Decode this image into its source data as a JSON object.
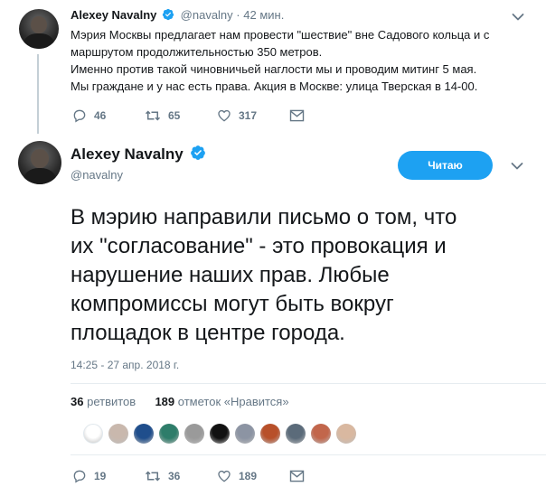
{
  "tweet1": {
    "name": "Alexey Navalny",
    "handle": "@navalny",
    "time": "42 мин.",
    "lines": [
      "Мэрия Москвы предлагает нам провести \"шествие\" вне Садового кольца и с",
      "маршрутом продолжительностью 350 метров.",
      "Именно против такой чиновничьей наглости мы и проводим митинг 5 мая.",
      "Мы граждане и у нас есть права. Акция в Москве: улица Тверская в 14-00."
    ],
    "replies": "46",
    "retweets": "65",
    "likes": "317"
  },
  "tweet2": {
    "name": "Alexey Navalny",
    "handle": "@navalny",
    "follow_label": "Читаю",
    "lines": [
      "В мэрию направили письмо о том, что",
      "их \"согласование\" - это провокация и",
      "нарушение наших прав. Любые",
      "компромиссы могут быть вокруг",
      "площадок в центре города."
    ],
    "timestamp": "14:25 - 27 апр. 2018 г.",
    "retweet_count": "36",
    "retweet_label": "ретвитов",
    "like_count": "189",
    "like_label": "отметок «Нравится»",
    "liker_colors": [
      "#ffffff",
      "#c9b8ad",
      "#1f4e8c",
      "#2e7d6a",
      "#9a9a9a",
      "#111111",
      "#8c94a3",
      "#b8502a",
      "#5b6b7a",
      "#c2664b",
      "#d9b8a0"
    ],
    "replies": "19",
    "retweets": "36",
    "likes": "189"
  },
  "colors": {
    "accent": "#1da1f2",
    "muted": "#657786",
    "text": "#14171a"
  }
}
